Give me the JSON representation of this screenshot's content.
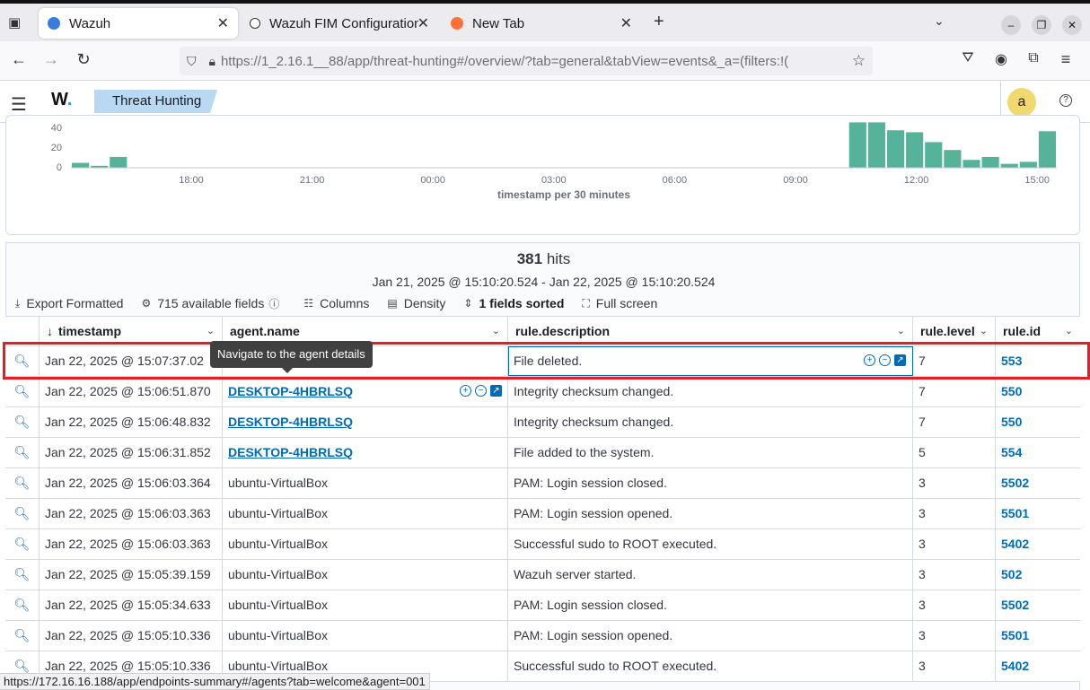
{
  "browser": {
    "tabs": [
      {
        "label": "Wazuh",
        "active": true,
        "icon": "wazuh-favicon"
      },
      {
        "label": "Wazuh FIM Configuration",
        "active": false,
        "icon": "openai-favicon"
      },
      {
        "label": "New Tab",
        "active": false,
        "icon": "firefox-favicon"
      }
    ],
    "url": "https://1_2.16.1__88/app/threat-hunting#/overview/?tab=general&tabView=events&_a=(filters:!(",
    "status_url": "https://172.16.16.188/app/endpoints-summary#/agents?tab=welcome&agent=001"
  },
  "app": {
    "logo": "W",
    "breadcrumb": "Threat Hunting",
    "avatar_letter": "a"
  },
  "chart_data": {
    "type": "bar",
    "xlabel": "timestamp per 30 minutes",
    "ytick_labels": [
      "0",
      "20",
      "40"
    ],
    "xtick_labels": [
      "18:00",
      "21:00",
      "00:00",
      "03:00",
      "06:00",
      "09:00",
      "12:00",
      "15:00"
    ],
    "bar_color": "#54b399",
    "series": [
      {
        "values": [
          5,
          2,
          11,
          0,
          0,
          0,
          0,
          0,
          0,
          0,
          0,
          0,
          0,
          0,
          0,
          0,
          0,
          0,
          0,
          0,
          0,
          0,
          0,
          0,
          0,
          0,
          0,
          0,
          0,
          0,
          0,
          0,
          0,
          0,
          0,
          0,
          0,
          0,
          0,
          0,
          0,
          46,
          46,
          38,
          36,
          26,
          18,
          8,
          11,
          4,
          6,
          37
        ]
      }
    ]
  },
  "results": {
    "hits_count": "381",
    "hits_label": "hits",
    "range": "Jan 21, 2025 @ 15:10:20.524 - Jan 22, 2025 @ 15:10:20.524",
    "toolbar": {
      "export": "Export Formatted",
      "fields": "715 available fields",
      "columns": "Columns",
      "density": "Density",
      "sorted": "1 fields sorted",
      "fullscreen": "Full screen"
    },
    "columns": [
      "timestamp",
      "agent.name",
      "rule.description",
      "rule.level",
      "rule.id"
    ],
    "tooltip": "Navigate to the agent details",
    "rows": [
      {
        "timestamp": "Jan 22, 2025 @ 15:07:37.02",
        "agent": "",
        "description": "File deleted.",
        "level": "7",
        "id": "553"
      },
      {
        "timestamp": "Jan 22, 2025 @ 15:06:51.870",
        "agent": "DESKTOP-4HBRLSQ",
        "description": "Integrity checksum changed.",
        "level": "7",
        "id": "550"
      },
      {
        "timestamp": "Jan 22, 2025 @ 15:06:48.832",
        "agent": "DESKTOP-4HBRLSQ",
        "description": "Integrity checksum changed.",
        "level": "7",
        "id": "550"
      },
      {
        "timestamp": "Jan 22, 2025 @ 15:06:31.852",
        "agent": "DESKTOP-4HBRLSQ",
        "description": "File added to the system.",
        "level": "5",
        "id": "554"
      },
      {
        "timestamp": "Jan 22, 2025 @ 15:06:03.364",
        "agent": "ubuntu-VirtualBox",
        "description": "PAM: Login session closed.",
        "level": "3",
        "id": "5502"
      },
      {
        "timestamp": "Jan 22, 2025 @ 15:06:03.363",
        "agent": "ubuntu-VirtualBox",
        "description": "PAM: Login session opened.",
        "level": "3",
        "id": "5501"
      },
      {
        "timestamp": "Jan 22, 2025 @ 15:06:03.363",
        "agent": "ubuntu-VirtualBox",
        "description": "Successful sudo to ROOT executed.",
        "level": "3",
        "id": "5402"
      },
      {
        "timestamp": "Jan 22, 2025 @ 15:05:39.159",
        "agent": "ubuntu-VirtualBox",
        "description": "Wazuh server started.",
        "level": "3",
        "id": "502"
      },
      {
        "timestamp": "Jan 22, 2025 @ 15:05:34.633",
        "agent": "ubuntu-VirtualBox",
        "description": "PAM: Login session closed.",
        "level": "3",
        "id": "5502"
      },
      {
        "timestamp": "Jan 22, 2025 @ 15:05:10.336",
        "agent": "ubuntu-VirtualBox",
        "description": "PAM: Login session opened.",
        "level": "3",
        "id": "5501"
      },
      {
        "timestamp": "Jan 22, 2025 @ 15:05:10.336",
        "agent": "ubuntu-VirtualBox",
        "description": "Successful sudo to ROOT executed.",
        "level": "3",
        "id": "5402"
      }
    ]
  }
}
